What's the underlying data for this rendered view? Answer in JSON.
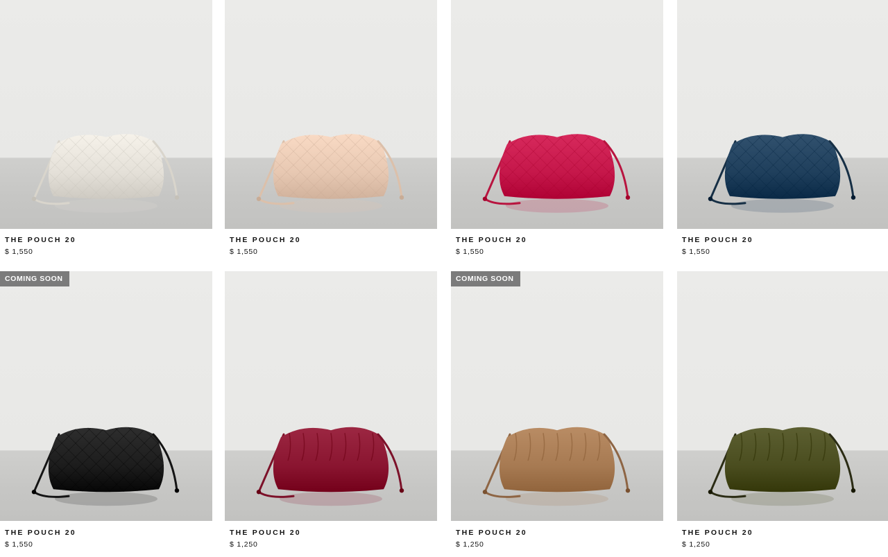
{
  "products": [
    {
      "name": "THE POUCH 20",
      "price": "$ 1,550",
      "badge": "",
      "color": "#e4e0d8",
      "string_color": "#d9d5cc",
      "woven": true
    },
    {
      "name": "THE POUCH 20",
      "price": "$ 1,550",
      "badge": "",
      "color": "#e7c8b2",
      "string_color": "#dcc0aa",
      "woven": true
    },
    {
      "name": "THE POUCH 20",
      "price": "$ 1,550",
      "badge": "",
      "color": "#c5174a",
      "string_color": "#b8143f",
      "woven": true
    },
    {
      "name": "THE POUCH 20",
      "price": "$ 1,550",
      "badge": "",
      "color": "#1f3f5c",
      "string_color": "#162f45",
      "woven": true
    },
    {
      "name": "THE POUCH 20",
      "price": "$ 1,550",
      "badge": "COMING SOON",
      "color": "#1c1c1c",
      "string_color": "#141414",
      "woven": true
    },
    {
      "name": "THE POUCH 20",
      "price": "$ 1,250",
      "badge": "",
      "color": "#8a1530",
      "string_color": "#7c1129",
      "woven": false
    },
    {
      "name": "THE POUCH 20",
      "price": "$ 1,250",
      "badge": "COMING SOON",
      "color": "#a77a52",
      "string_color": "#8e6544",
      "woven": false
    },
    {
      "name": "THE POUCH 20",
      "price": "$ 1,250",
      "badge": "",
      "color": "#4a4d1f",
      "string_color": "#2b2c14",
      "woven": false
    }
  ]
}
